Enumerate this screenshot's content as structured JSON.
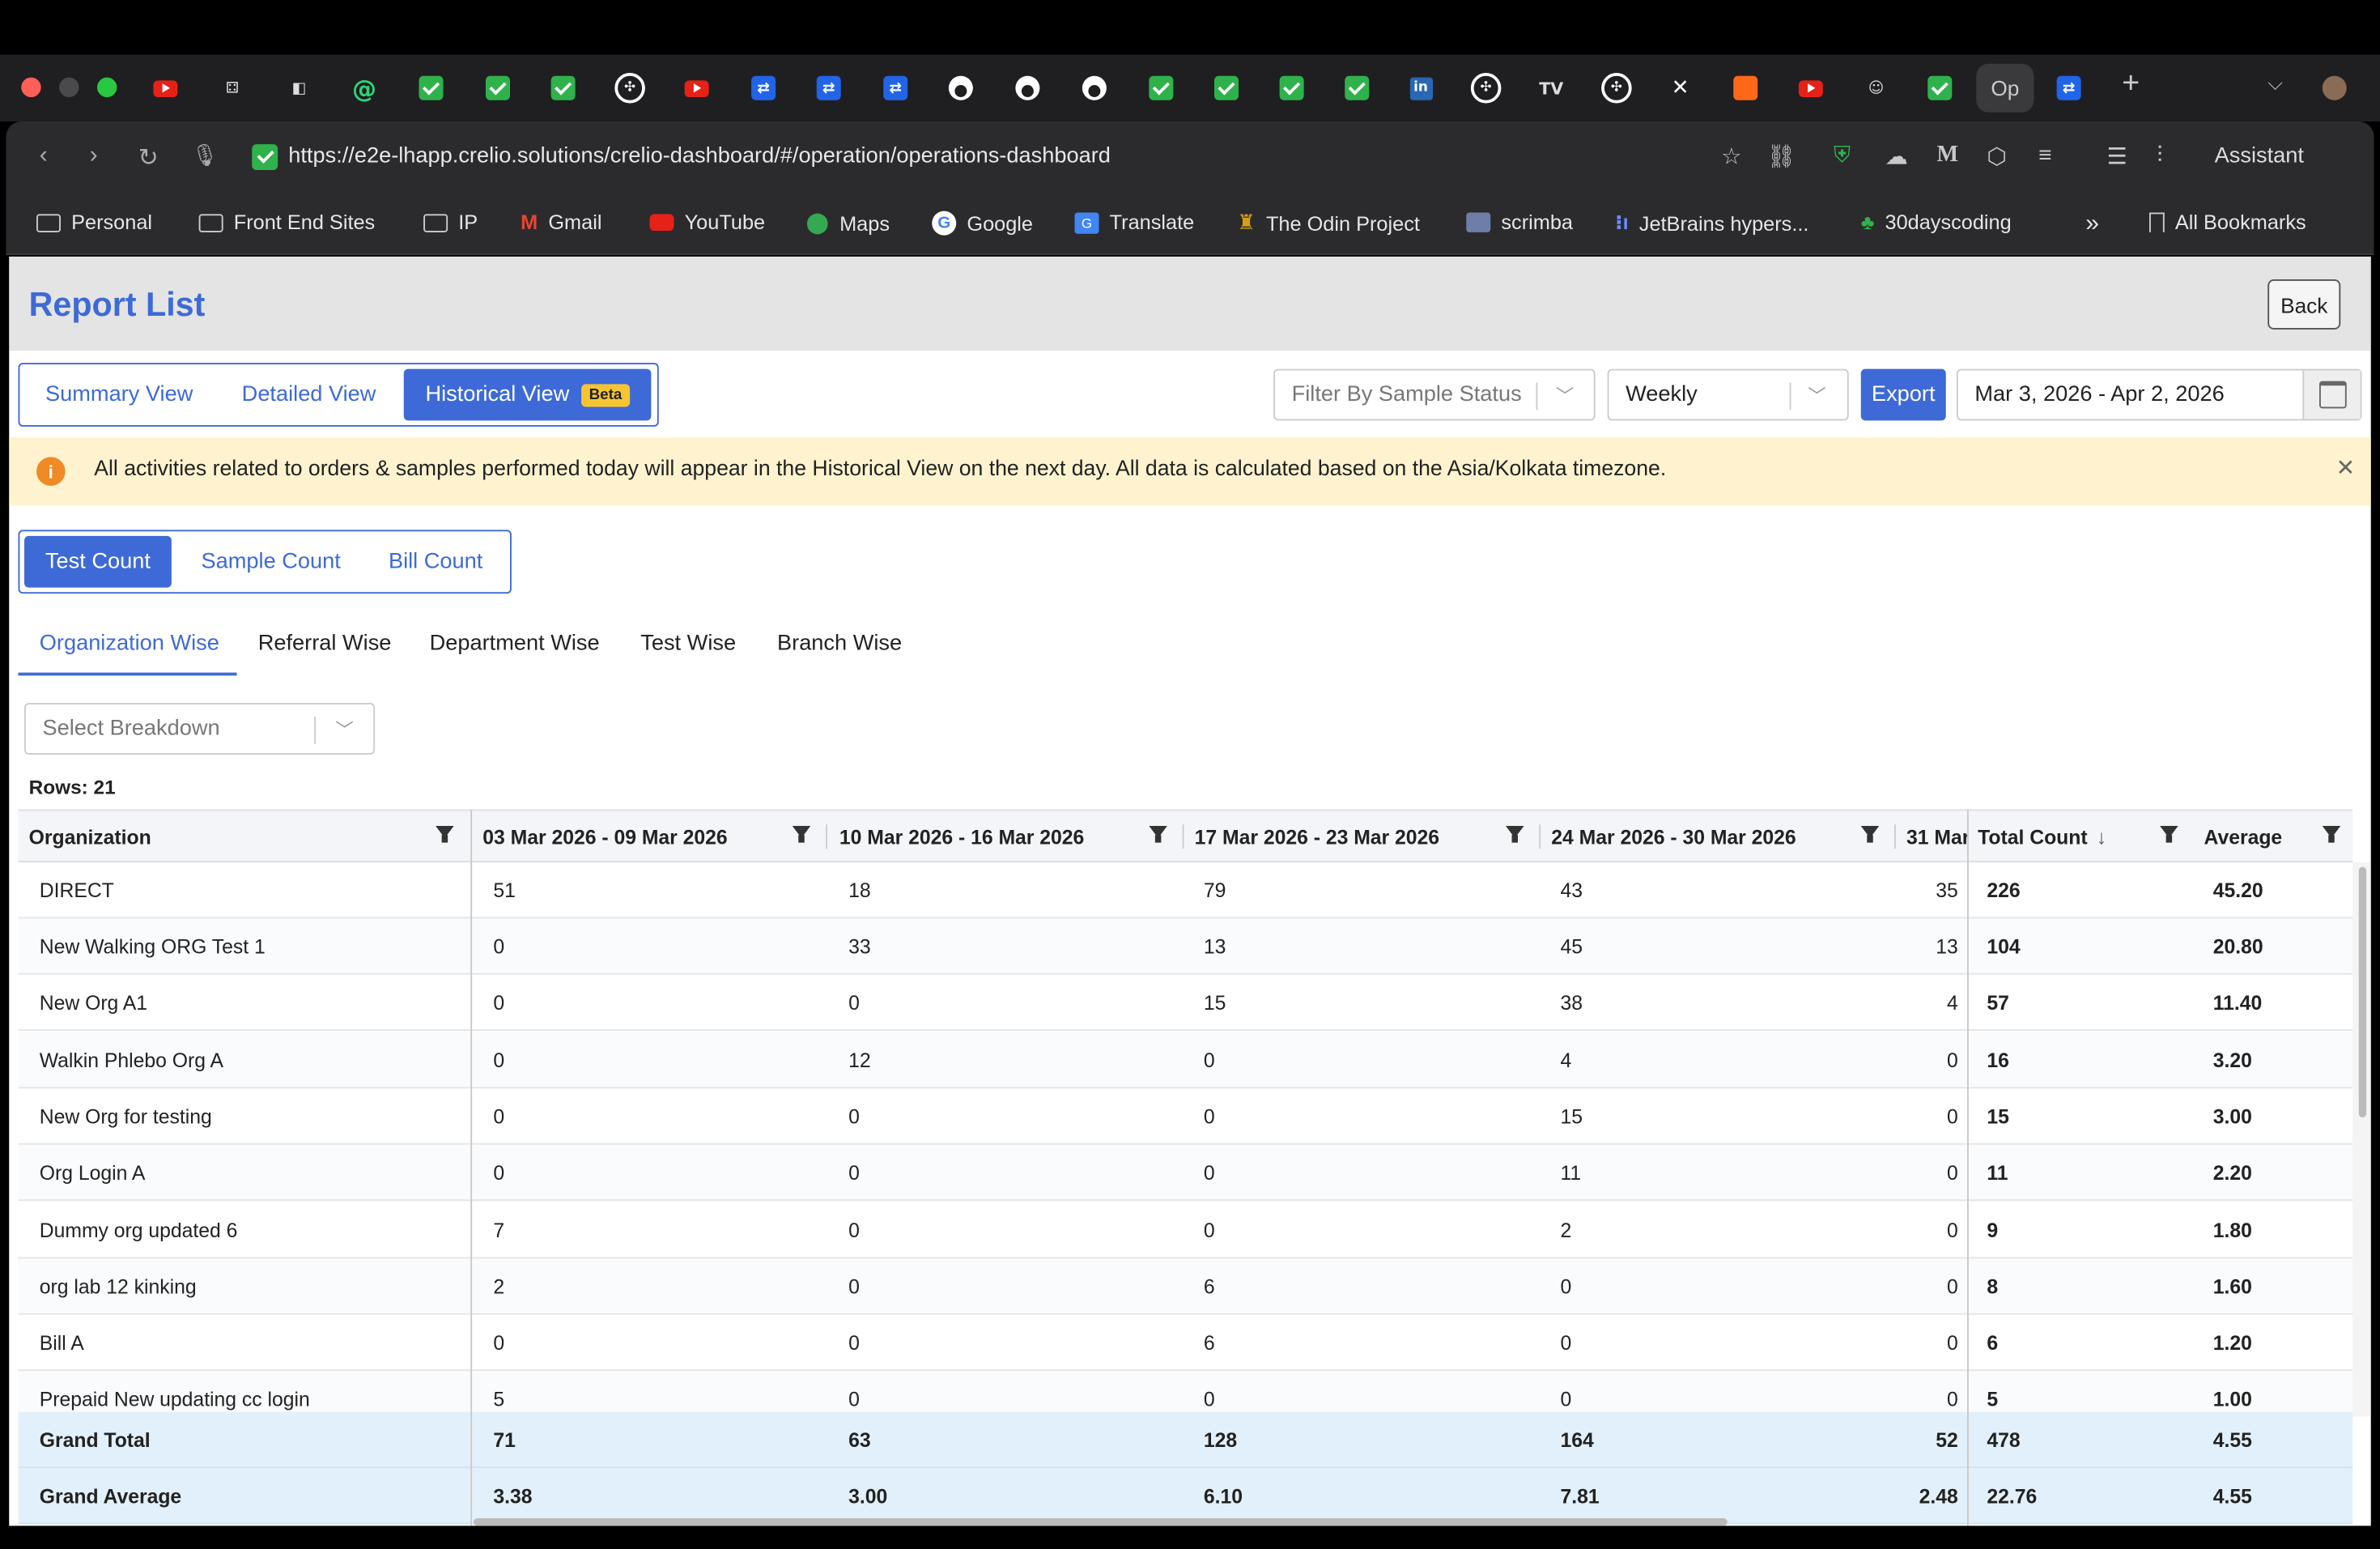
{
  "browser": {
    "url": "https://e2e-lhapp.crelio.solutions/crelio-dashboard/#/operation/operations-dashboard",
    "active_tab_title": "Op",
    "assistant_label": "Assistant",
    "bookmarks": [
      "Personal",
      "Front End Sites",
      "IP",
      "Gmail",
      "YouTube",
      "Maps",
      "Google",
      "Translate",
      "The Odin Project",
      "scrimba",
      "JetBrains hypers...",
      "30dayscoding"
    ],
    "more_bookmarks": "»",
    "all_bookmarks": "All Bookmarks"
  },
  "header": {
    "title": "Report List",
    "back_label": "Back"
  },
  "views": {
    "summary": "Summary View",
    "detailed": "Detailed View",
    "historical": "Historical View",
    "beta": "Beta"
  },
  "filters": {
    "sample_status_placeholder": "Filter By Sample Status",
    "period": "Weekly",
    "export_label": "Export",
    "date_range": "Mar 3, 2026 - Apr 2, 2026"
  },
  "banner": {
    "text": "All activities related to orders & samples performed today will appear in the Historical View on the next day. All data is calculated based on the Asia/Kolkata timezone."
  },
  "count_tabs": {
    "test": "Test Count",
    "sample": "Sample Count",
    "bill": "Bill Count"
  },
  "breakdown_tabs": [
    "Organization Wise",
    "Referral Wise",
    "Department Wise",
    "Test Wise",
    "Branch Wise"
  ],
  "breakdown_select_placeholder": "Select Breakdown",
  "rows_label": "Rows: 21",
  "table": {
    "columns": [
      "Organization",
      "03 Mar 2026 - 09 Mar 2026",
      "10 Mar 2026 - 16 Mar 2026",
      "17 Mar 2026 - 23 Mar 2026",
      "24 Mar 2026 - 30 Mar 2026",
      "31 Mar",
      "Total Count",
      "Average"
    ],
    "sort_arrow": "↓",
    "rows": [
      [
        "DIRECT",
        "51",
        "18",
        "79",
        "43",
        "35",
        "226",
        "45.20"
      ],
      [
        "New Walking ORG Test 1",
        "0",
        "33",
        "13",
        "45",
        "13",
        "104",
        "20.80"
      ],
      [
        "New Org A1",
        "0",
        "0",
        "15",
        "38",
        "4",
        "57",
        "11.40"
      ],
      [
        "Walkin Phlebo Org A",
        "0",
        "12",
        "0",
        "4",
        "0",
        "16",
        "3.20"
      ],
      [
        "New Org for testing",
        "0",
        "0",
        "0",
        "15",
        "0",
        "15",
        "3.00"
      ],
      [
        "Org Login A",
        "0",
        "0",
        "0",
        "11",
        "0",
        "11",
        "2.20"
      ],
      [
        "Dummy org updated 6",
        "7",
        "0",
        "0",
        "2",
        "0",
        "9",
        "1.80"
      ],
      [
        "org lab 12 kinking",
        "2",
        "0",
        "6",
        "0",
        "0",
        "8",
        "1.60"
      ],
      [
        "Bill A",
        "0",
        "0",
        "6",
        "0",
        "0",
        "6",
        "1.20"
      ],
      [
        "Prepaid New updating cc login",
        "5",
        "0",
        "0",
        "0",
        "0",
        "5",
        "1.00"
      ]
    ],
    "footer": [
      [
        "Grand Total",
        "71",
        "63",
        "128",
        "164",
        "52",
        "478",
        "4.55"
      ],
      [
        "Grand Average",
        "3.38",
        "3.00",
        "6.10",
        "7.81",
        "2.48",
        "22.76",
        "4.55"
      ]
    ]
  }
}
